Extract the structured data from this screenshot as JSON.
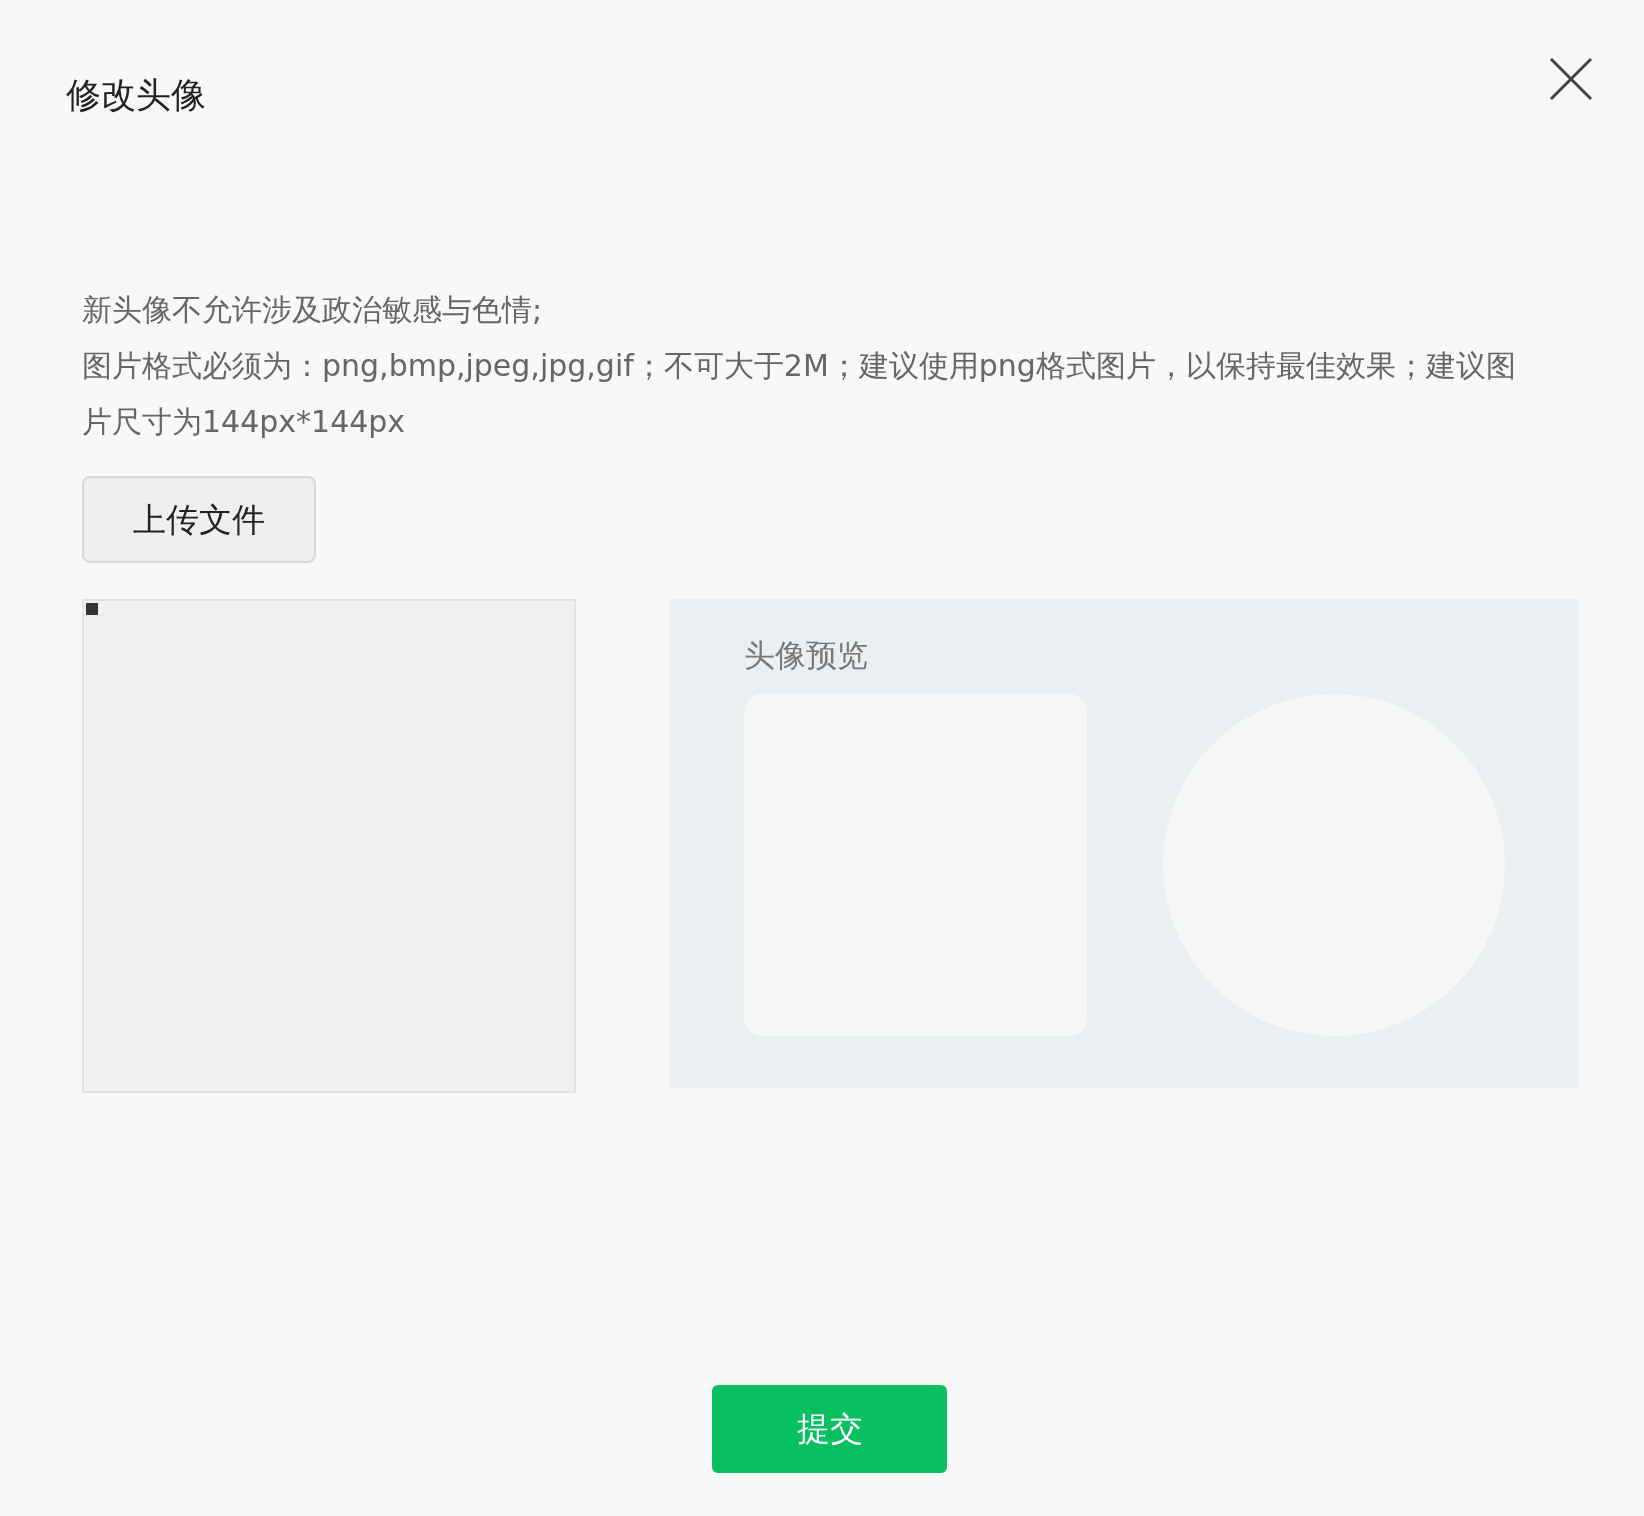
{
  "dialog": {
    "title": "修改头像"
  },
  "notice": [
    "新头像不允许涉及政治敏感与色情;",
    "图片格式必须为：png,bmp,jpeg,jpg,gif；不可大于2M；建议使用png格式图片，以保持最佳效果；建议图片尺寸为144px*144px"
  ],
  "upload_button": "上传文件",
  "preview": {
    "label": "头像预览"
  },
  "submit_button": "提交"
}
